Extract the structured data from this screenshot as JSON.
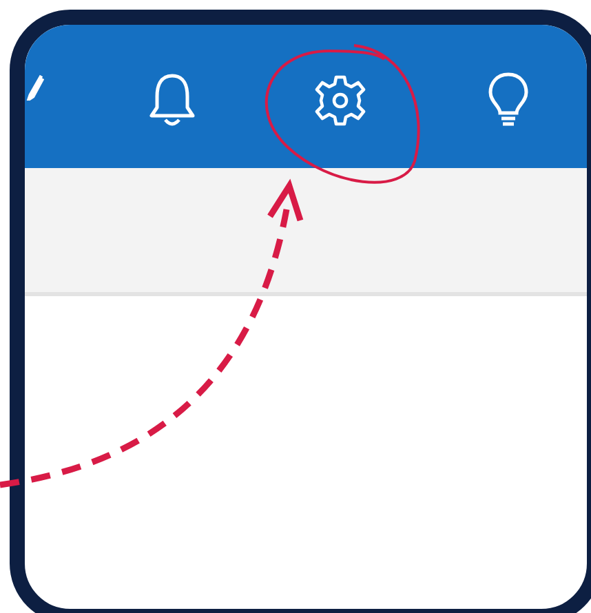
{
  "toolbar": [
    {
      "kind": "pen",
      "highlighted": false
    },
    {
      "kind": "bell",
      "highlighted": false
    },
    {
      "kind": "gear",
      "highlighted": true
    },
    {
      "kind": "bulb",
      "highlighted": false
    }
  ]
}
